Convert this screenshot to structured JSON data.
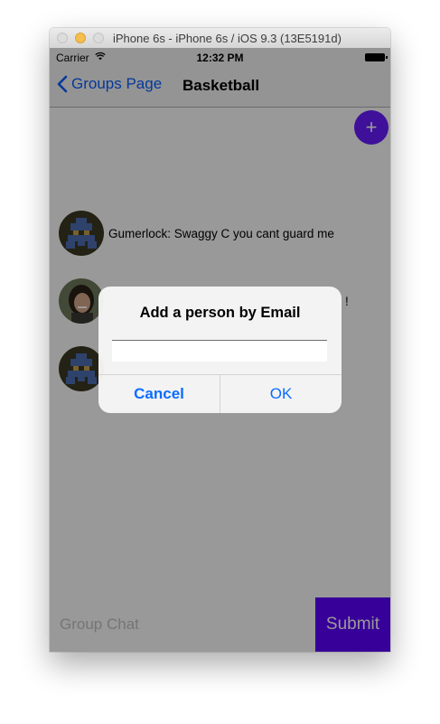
{
  "window": {
    "title": "iPhone 6s - iPhone 6s / iOS 9.3 (13E5191d)"
  },
  "status_bar": {
    "carrier": "Carrier",
    "time": "12:32 PM"
  },
  "nav": {
    "back_label": "Groups Page",
    "title": "Basketball"
  },
  "fab": {
    "label": "+"
  },
  "messages": [
    {
      "text": "Gumerlock: Swaggy C you cant guard me"
    },
    {
      "text": "!"
    },
    {
      "text": ""
    }
  ],
  "composer": {
    "placeholder": "Group Chat",
    "submit_label": "Submit"
  },
  "alert": {
    "title": "Add a person by Email",
    "field_value": "",
    "cancel_label": "Cancel",
    "ok_label": "OK"
  },
  "colors": {
    "accent": "#5d00ff",
    "link": "#0a60ff"
  }
}
